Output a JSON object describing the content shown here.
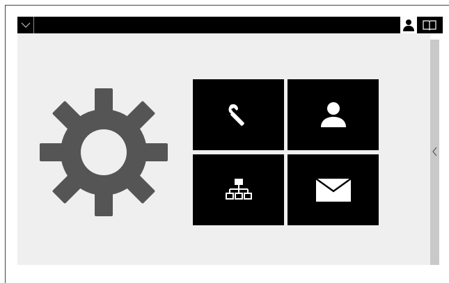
{
  "topbar": {
    "menu_icon": "chevron-down-icon",
    "user_icon": "user-icon",
    "help_icon": "book-icon"
  },
  "hero": {
    "icon": "gear-icon",
    "icon_color": "#555555"
  },
  "tiles": [
    {
      "id": "service",
      "icon": "wrench-icon"
    },
    {
      "id": "user",
      "icon": "user-icon"
    },
    {
      "id": "network",
      "icon": "network-icon"
    },
    {
      "id": "messages",
      "icon": "envelope-icon"
    }
  ],
  "side_panel": {
    "toggle_icon": "chevron-left-icon"
  },
  "colors": {
    "bar": "#000000",
    "tile_bg": "#000000",
    "tile_icon": "#ffffff",
    "content_bg": "#efefef",
    "scroll_panel": "#c9c9c9",
    "gear": "#555555"
  }
}
